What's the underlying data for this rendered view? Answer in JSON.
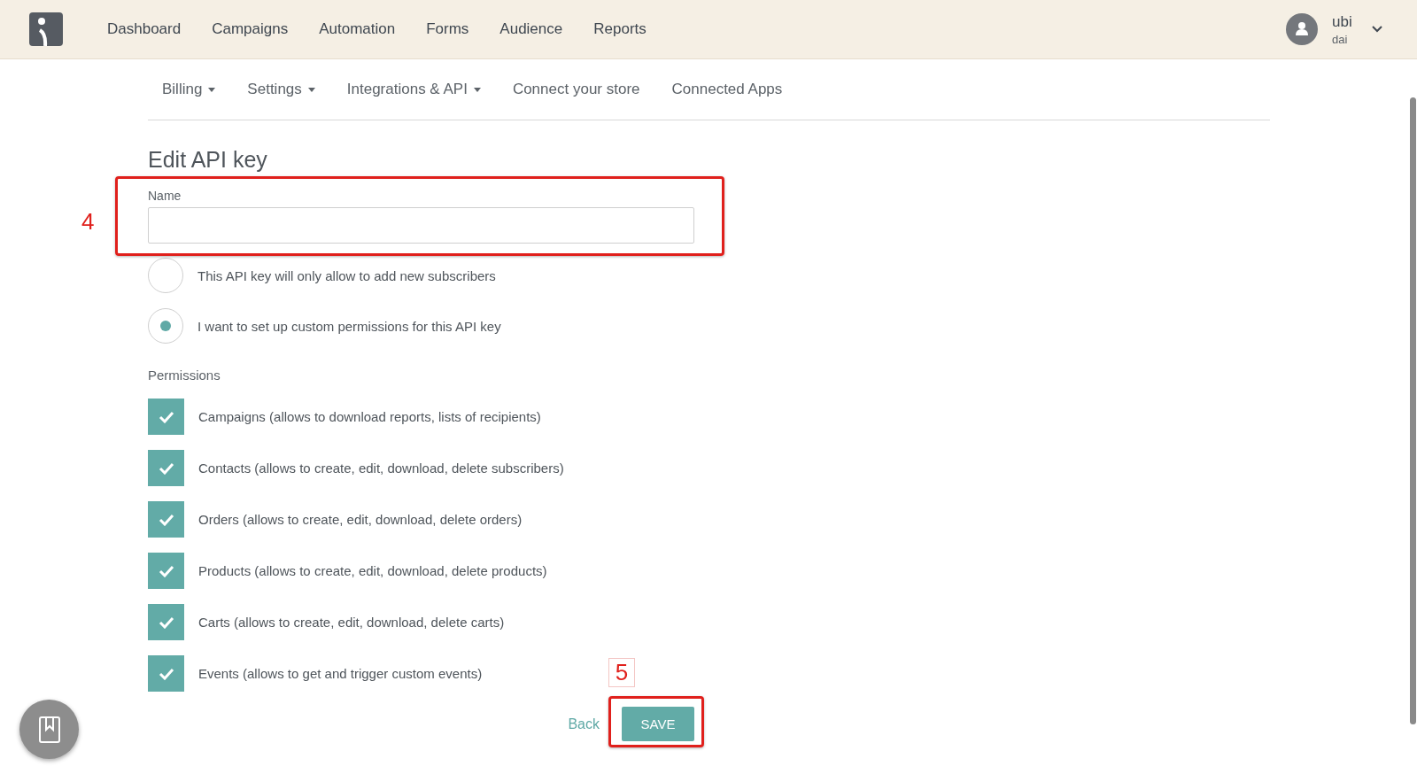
{
  "nav": [
    {
      "label": "Dashboard"
    },
    {
      "label": "Campaigns"
    },
    {
      "label": "Automation"
    },
    {
      "label": "Forms"
    },
    {
      "label": "Audience"
    },
    {
      "label": "Reports"
    }
  ],
  "user": {
    "name": "ubi",
    "subtitle": "dai"
  },
  "subnav": [
    {
      "label": "Billing",
      "dropdown": true
    },
    {
      "label": "Settings",
      "dropdown": true
    },
    {
      "label": "Integrations & API",
      "dropdown": true
    },
    {
      "label": "Connect your store",
      "dropdown": false
    },
    {
      "label": "Connected Apps",
      "dropdown": false
    }
  ],
  "title": "Edit API key",
  "name_field": {
    "label": "Name"
  },
  "access_options": [
    {
      "label": "This API key will only allow to add new subscribers",
      "selected": false
    },
    {
      "label": "I want to set up custom permissions for this API key",
      "selected": true
    }
  ],
  "permissions": {
    "label": "Permissions",
    "items": [
      {
        "label": "Campaigns (allows to download reports, lists of recipients)",
        "checked": true
      },
      {
        "label": "Contacts (allows to create, edit, download, delete subscribers)",
        "checked": true
      },
      {
        "label": "Orders (allows to create, edit, download, delete orders)",
        "checked": true
      },
      {
        "label": "Products (allows to create, edit, download, delete products)",
        "checked": true
      },
      {
        "label": "Carts (allows to create, edit, download, delete carts)",
        "checked": true
      },
      {
        "label": "Events (allows to get and trigger custom events)",
        "checked": true
      }
    ]
  },
  "actions": {
    "back": "Back",
    "save": "SAVE"
  },
  "annotations": [
    {
      "number": "4"
    },
    {
      "number": "5"
    }
  ]
}
